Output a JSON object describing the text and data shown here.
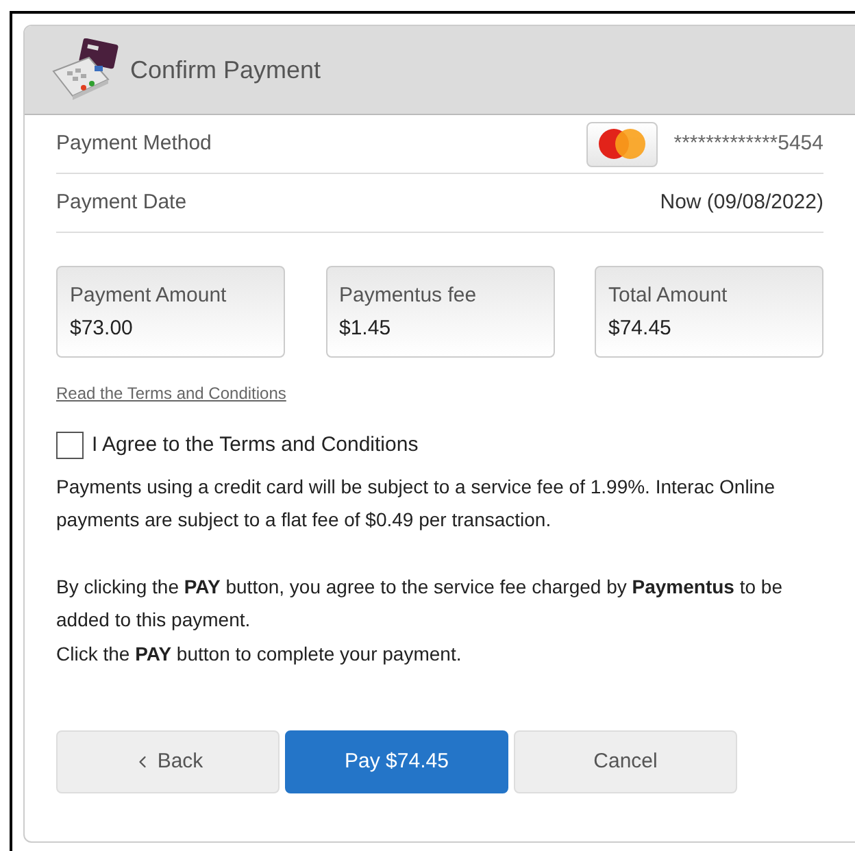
{
  "header": {
    "title": "Confirm Payment"
  },
  "details": [
    {
      "label": "Payment Method",
      "kind": "card",
      "value": "*************5454"
    },
    {
      "label": "Payment Date",
      "kind": "text",
      "value": "Now (09/08/2022)"
    }
  ],
  "amounts": [
    {
      "label": "Payment Amount",
      "value": "$73.00"
    },
    {
      "label": "Paymentus fee",
      "value": "$1.45"
    },
    {
      "label": "Total Amount",
      "value": "$74.45"
    }
  ],
  "terms_link": "Read the Terms and Conditions",
  "agree": {
    "label": "I Agree to the Terms and Conditions",
    "checked": false
  },
  "paragraphs": [
    [
      "Payments using a credit card will be subject to a service fee of 1.99%. Interac Online payments are subject to a flat fee of $0.49 per transaction."
    ],
    [
      "By clicking the **PAY** button, you agree to the service fee charged by **Paymentus** to be added to this payment.",
      "Click the **PAY** button to complete your payment."
    ]
  ],
  "buttons": [
    {
      "label": "Back",
      "kind": "back"
    },
    {
      "label": "Pay $74.45",
      "kind": "primary"
    },
    {
      "label": "Cancel",
      "kind": "secondary"
    }
  ]
}
